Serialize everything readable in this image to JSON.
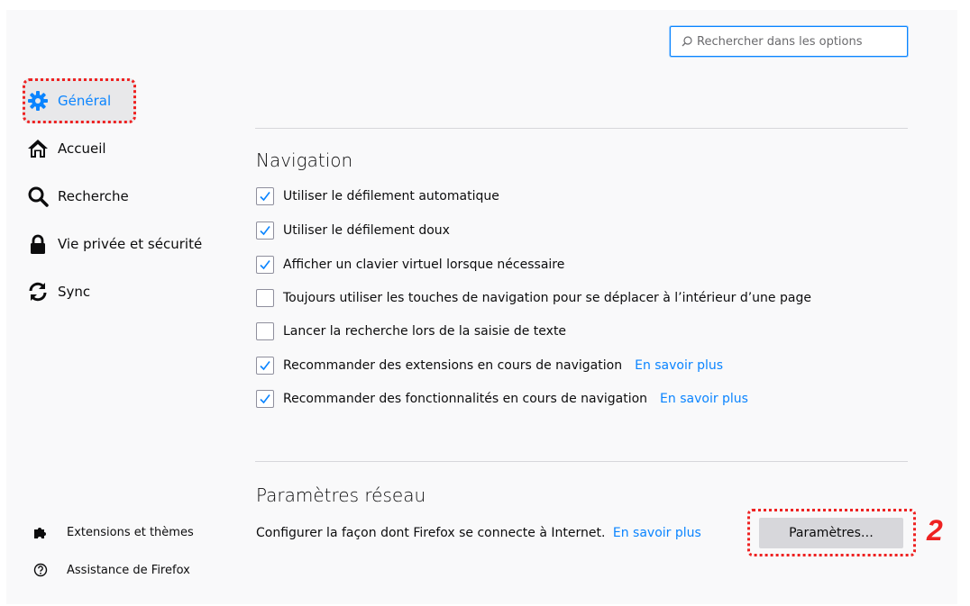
{
  "search": {
    "placeholder": "Rechercher dans les options"
  },
  "sidebar": {
    "categories": [
      {
        "label": "Général",
        "icon": "gear-icon",
        "selected": true
      },
      {
        "label": "Accueil",
        "icon": "home-icon"
      },
      {
        "label": "Recherche",
        "icon": "search-icon"
      },
      {
        "label": "Vie privée et sécurité",
        "icon": "lock-icon"
      },
      {
        "label": "Sync",
        "icon": "sync-icon"
      }
    ],
    "footer": [
      {
        "label": "Extensions et thèmes",
        "icon": "puzzle-icon"
      },
      {
        "label": "Assistance de Firefox",
        "icon": "help-icon"
      }
    ]
  },
  "navigation": {
    "heading": "Navigation",
    "options": [
      {
        "label": "Utiliser le défilement automatique",
        "checked": true
      },
      {
        "label": "Utiliser le défilement doux",
        "checked": true
      },
      {
        "label": "Afficher un clavier virtuel lorsque nécessaire",
        "checked": true
      },
      {
        "label": "Toujours utiliser les touches de navigation pour se déplacer à l’intérieur d’une page",
        "checked": false
      },
      {
        "label": "Lancer la recherche lors de la saisie de texte",
        "checked": false
      },
      {
        "label": "Recommander des extensions en cours de navigation",
        "checked": true,
        "link": "En savoir plus"
      },
      {
        "label": "Recommander des fonctionnalités en cours de navigation",
        "checked": true,
        "link": "En savoir plus"
      }
    ]
  },
  "network": {
    "heading": "Paramètres réseau",
    "description": "Configurer la façon dont Firefox se connecte à Internet.",
    "link": "En savoir plus",
    "button": "Paramètres…"
  },
  "annotation": {
    "step": "2"
  },
  "colors": {
    "accent": "#0a84ff",
    "highlight": "#ee2222"
  }
}
